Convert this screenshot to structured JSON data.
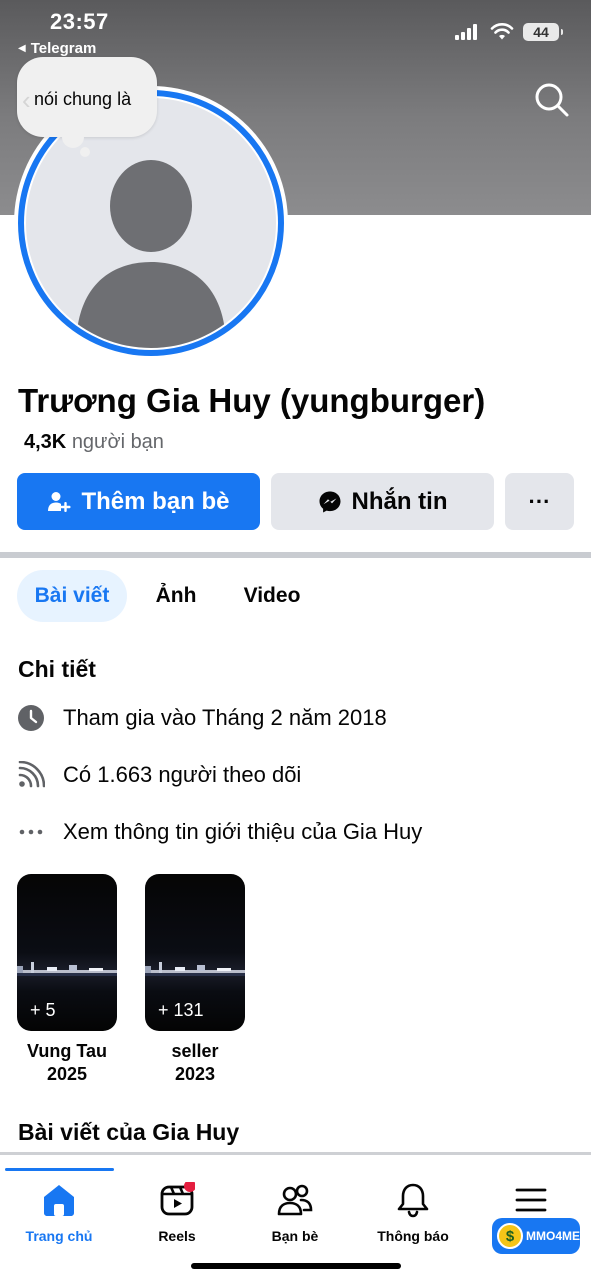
{
  "status_bar": {
    "time": "23:57",
    "back_app": "Telegram",
    "battery": "44"
  },
  "note": {
    "text": "nói chung là"
  },
  "profile": {
    "name": "Trương Gia Huy (yungburger)",
    "friends_count": "4,3K",
    "friends_label": "người bạn"
  },
  "actions": {
    "add_friend": "Thêm bạn bè",
    "message": "Nhắn tin",
    "more": "···"
  },
  "tabs": [
    {
      "label": "Bài viết",
      "active": true
    },
    {
      "label": "Ảnh",
      "active": false
    },
    {
      "label": "Video",
      "active": false
    }
  ],
  "details": {
    "title": "Chi tiết",
    "items": [
      {
        "icon": "clock-icon",
        "text": "Tham gia vào Tháng 2 năm 2018"
      },
      {
        "icon": "rss-follow-icon",
        "text": "Có 1.663 người theo dõi"
      },
      {
        "icon": "more-dots-icon",
        "text": "Xem thông tin giới thiệu của Gia Huy"
      }
    ]
  },
  "highlights": [
    {
      "count": "+ 5",
      "label": "Vung Tau 2025"
    },
    {
      "count": "+ 131",
      "label": "seller 2023"
    }
  ],
  "posts_section": {
    "title": "Bài viết của Gia Huy"
  },
  "bottom_nav": [
    {
      "icon": "home-icon",
      "label": "Trang chủ",
      "active": true
    },
    {
      "icon": "reels-icon",
      "label": "Reels",
      "active": false
    },
    {
      "icon": "friends-icon",
      "label": "Bạn bè",
      "active": false
    },
    {
      "icon": "bell-icon",
      "label": "Thông báo",
      "active": false
    },
    {
      "icon": "menu-icon",
      "label": "",
      "active": false
    }
  ],
  "watermark": {
    "text": "MMO4ME"
  },
  "colors": {
    "accent": "#1877f2",
    "secondary_button": "#e4e6eb",
    "text_secondary": "#65676b",
    "notification_dot": "#e41e3f"
  }
}
